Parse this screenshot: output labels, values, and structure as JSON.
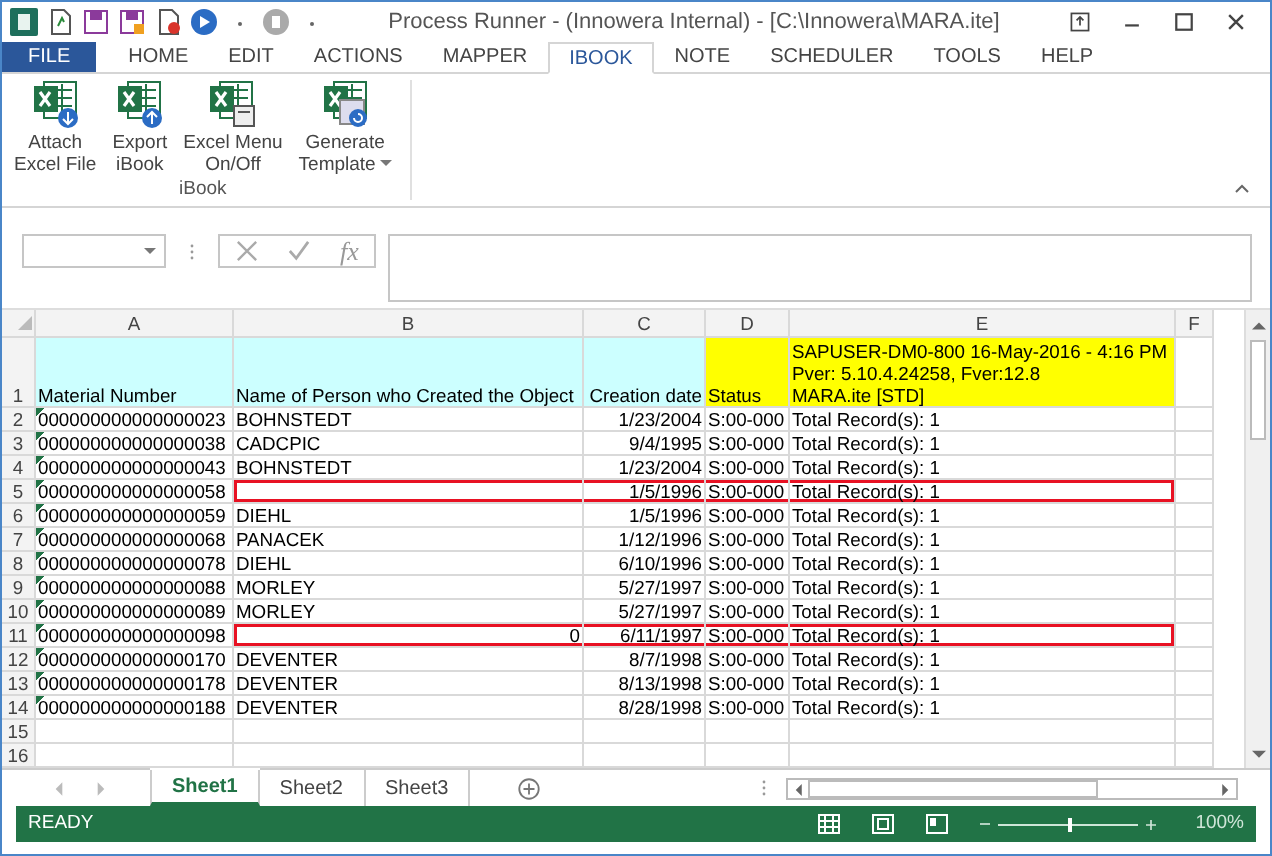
{
  "window": {
    "title": "Process Runner - (Innowera Internal) - [C:\\Innowera\\MARA.ite]"
  },
  "menu_tabs": [
    {
      "label": "FILE",
      "kind": "file",
      "selected": false
    },
    {
      "label": "HOME",
      "kind": "tab",
      "selected": false
    },
    {
      "label": "EDIT",
      "kind": "tab",
      "selected": false
    },
    {
      "label": "ACTIONS",
      "kind": "tab",
      "selected": false
    },
    {
      "label": "MAPPER",
      "kind": "tab",
      "selected": false
    },
    {
      "label": "IBOOK",
      "kind": "tab",
      "selected": true
    },
    {
      "label": "NOTE",
      "kind": "tab",
      "selected": false
    },
    {
      "label": "SCHEDULER",
      "kind": "tab",
      "selected": false
    },
    {
      "label": "TOOLS",
      "kind": "tab",
      "selected": false
    },
    {
      "label": "HELP",
      "kind": "tab",
      "selected": false
    }
  ],
  "ribbon": {
    "group": "iBook",
    "buttons": [
      {
        "label": "Attach\nExcel File",
        "kind": "attach",
        "dropdown": false
      },
      {
        "label": "Export\niBook",
        "kind": "export",
        "dropdown": false
      },
      {
        "label": "Excel Menu\nOn/Off",
        "kind": "menu",
        "dropdown": false
      },
      {
        "label": "Generate\nTemplate",
        "kind": "template",
        "dropdown": true
      }
    ]
  },
  "formula_bar": {
    "function_symbol": "fx"
  },
  "sheet": {
    "columns": [
      "A",
      "B",
      "C",
      "D",
      "E",
      "F"
    ],
    "header_row": {
      "number": "1",
      "cells": [
        {
          "lines": [
            "Material Number"
          ],
          "color": "#ccffff"
        },
        {
          "lines": [
            "Name of Person who Created the Object"
          ],
          "color": "#ccffff"
        },
        {
          "lines": [
            "Creation date"
          ],
          "color": "#ccffff"
        },
        {
          "lines": [
            "Status"
          ],
          "color": "#ffff00"
        },
        {
          "lines": [
            "SAPUSER-DM0-800 16-May-2016 - 4:16 PM",
            "Pver: 5.10.4.24258, Fver:12.8",
            "MARA.ite [STD]"
          ],
          "color": "#ffff00"
        }
      ]
    },
    "rows": [
      {
        "number": "2",
        "flagged": false,
        "cells": [
          "000000000000000023",
          "BOHNSTEDT",
          "1/23/2004",
          "S:00-000",
          "Total Record(s): 1"
        ]
      },
      {
        "number": "3",
        "flagged": false,
        "cells": [
          "000000000000000038",
          "CADCPIC",
          "9/4/1995",
          "S:00-000",
          "Total Record(s): 1"
        ]
      },
      {
        "number": "4",
        "flagged": false,
        "cells": [
          "000000000000000043",
          "BOHNSTEDT",
          "1/23/2004",
          "S:00-000",
          "Total Record(s): 1"
        ]
      },
      {
        "number": "5",
        "flagged": true,
        "cells": [
          "000000000000000058",
          "",
          "1/5/1996",
          "S:00-000",
          "Total Record(s): 1"
        ]
      },
      {
        "number": "6",
        "flagged": false,
        "cells": [
          "000000000000000059",
          "DIEHL",
          "1/5/1996",
          "S:00-000",
          "Total Record(s): 1"
        ]
      },
      {
        "number": "7",
        "flagged": false,
        "cells": [
          "000000000000000068",
          "PANACEK",
          "1/12/1996",
          "S:00-000",
          "Total Record(s): 1"
        ]
      },
      {
        "number": "8",
        "flagged": false,
        "cells": [
          "000000000000000078",
          "DIEHL",
          "6/10/1996",
          "S:00-000",
          "Total Record(s): 1"
        ]
      },
      {
        "number": "9",
        "flagged": false,
        "cells": [
          "000000000000000088",
          "MORLEY",
          "5/27/1997",
          "S:00-000",
          "Total Record(s): 1"
        ]
      },
      {
        "number": "10",
        "flagged": false,
        "cells": [
          "000000000000000089",
          "MORLEY",
          "5/27/1997",
          "S:00-000",
          "Total Record(s): 1"
        ]
      },
      {
        "number": "11",
        "flagged": true,
        "cells": [
          "000000000000000098",
          "0",
          "6/11/1997",
          "S:00-000",
          "Total Record(s): 1"
        ]
      },
      {
        "number": "12",
        "flagged": false,
        "cells": [
          "000000000000000170",
          "DEVENTER",
          "8/7/1998",
          "S:00-000",
          "Total Record(s): 1"
        ]
      },
      {
        "number": "13",
        "flagged": false,
        "cells": [
          "000000000000000178",
          "DEVENTER",
          "8/13/1998",
          "S:00-000",
          "Total Record(s): 1"
        ]
      },
      {
        "number": "14",
        "flagged": false,
        "cells": [
          "000000000000000188",
          "DEVENTER",
          "8/28/1998",
          "S:00-000",
          "Total Record(s): 1"
        ]
      },
      {
        "number": "15",
        "flagged": false,
        "cells": []
      },
      {
        "number": "16",
        "flagged": false,
        "cells": []
      }
    ]
  },
  "sheet_tabs": [
    {
      "label": "Sheet1",
      "selected": true
    },
    {
      "label": "Sheet2",
      "selected": false
    },
    {
      "label": "Sheet3",
      "selected": false
    }
  ],
  "status_bar": {
    "text": "READY",
    "zoom": "100%",
    "zoom_slider": {
      "level": 0.5
    }
  }
}
